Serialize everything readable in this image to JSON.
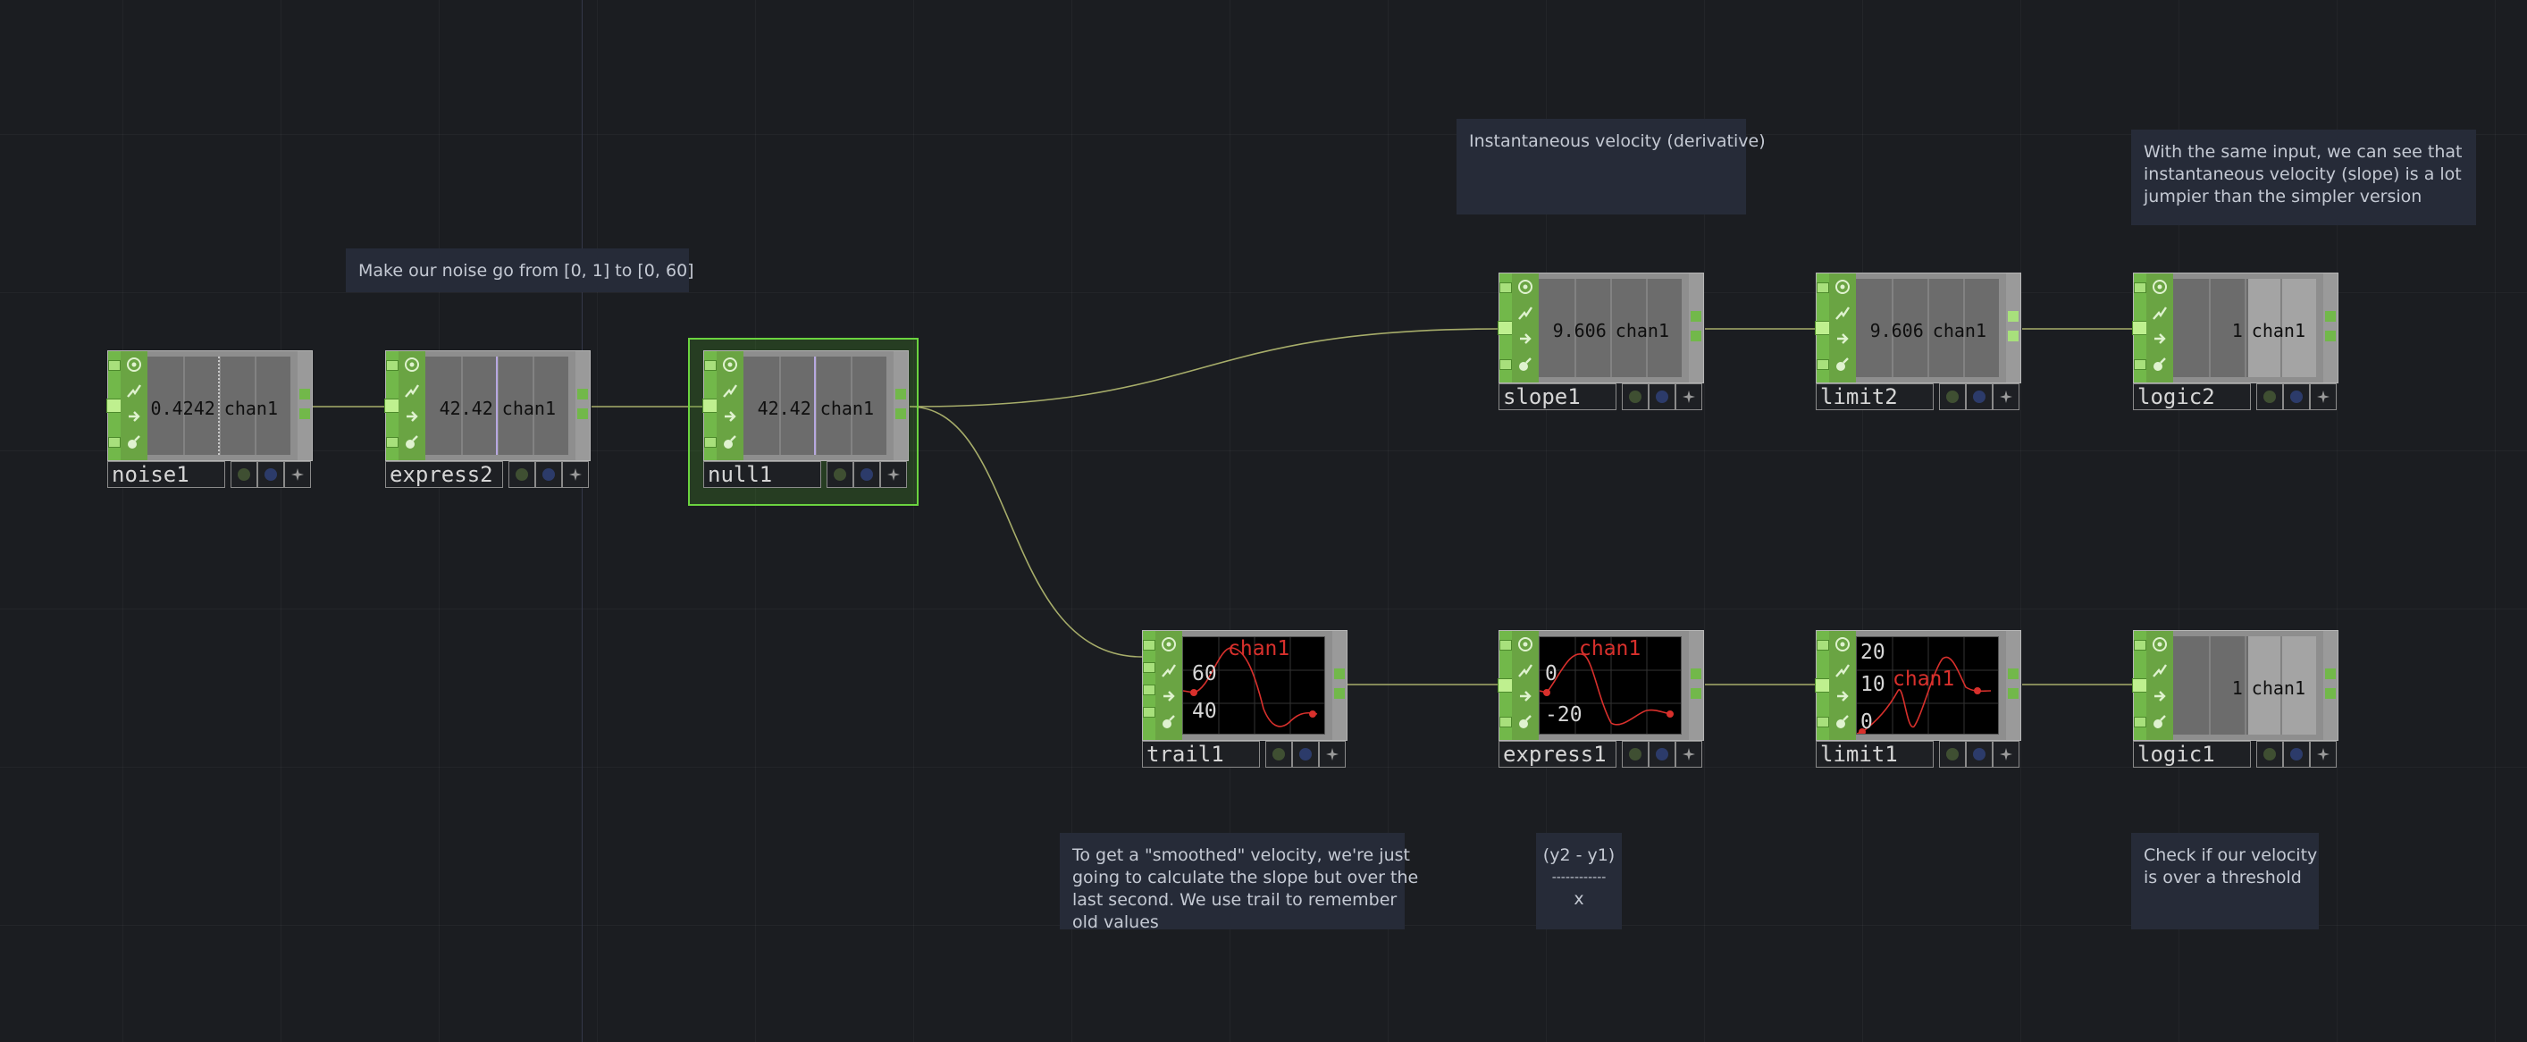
{
  "comments": {
    "noise_range": [
      "Make our noise go from [0, 1] to [0, 60]"
    ],
    "instantaneous": [
      "Instantaneous velocity (derivative)"
    ],
    "jumpier": [
      "With the same input, we can see that",
      "instantaneous velocity (slope) is a lot",
      "jumpier than the simpler version"
    ],
    "smoothed": [
      "To get a \"smoothed\" velocity, we're just",
      "going to calculate the slope but over the",
      "last second. We use trail to remember",
      "old values"
    ],
    "formula": [
      "(y2 - y1)",
      "------------",
      "x"
    ],
    "threshold": [
      "Check if our velocity",
      "is over a threshold"
    ]
  },
  "operators": {
    "noise1": {
      "name": "noise1",
      "value": "0.4242",
      "channel": "chan1"
    },
    "express2": {
      "name": "express2",
      "value": "42.42",
      "channel": "chan1"
    },
    "null1": {
      "name": "null1",
      "value": "42.42",
      "channel": "chan1"
    },
    "slope1": {
      "name": "slope1",
      "value": "9.606",
      "channel": "chan1"
    },
    "limit2": {
      "name": "limit2",
      "value": "9.606",
      "channel": "chan1"
    },
    "logic2": {
      "name": "logic2",
      "value": "1",
      "channel": "chan1"
    },
    "trail1": {
      "name": "trail1",
      "channel": "chan1",
      "ticks": [
        "60",
        "40"
      ]
    },
    "express1": {
      "name": "express1",
      "channel": "chan1",
      "ticks": [
        "0",
        "-20"
      ]
    },
    "limit1": {
      "name": "limit1",
      "channel": "chan1",
      "ticks": [
        "20",
        "10",
        "0"
      ]
    },
    "logic1": {
      "name": "logic1",
      "value": "1",
      "channel": "chan1"
    }
  },
  "icons": [
    "bypass-icon",
    "viewer-icon",
    "lock-icon",
    "cook-icon",
    "display-flag-icon",
    "render-flag-icon",
    "pin-icon"
  ],
  "colors": {
    "background": "#1b1d21",
    "operator_green": "#72b84a",
    "selection": "#6bd33f",
    "wire": "#a7ad6a",
    "graph_line": "#d8302c",
    "comment_bg": "#262b38"
  }
}
